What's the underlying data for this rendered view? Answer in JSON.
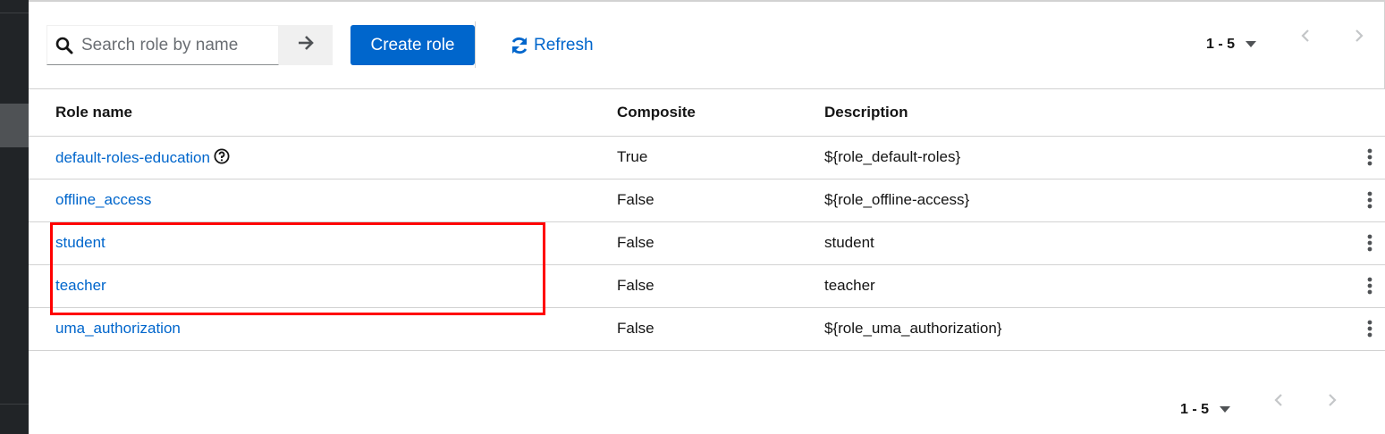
{
  "toolbar": {
    "search_placeholder": "Search role by name",
    "search_value": "",
    "create_label": "Create role",
    "refresh_label": "Refresh",
    "pagination_range": "1 - 5"
  },
  "table": {
    "headers": [
      "Role name",
      "Composite",
      "Description"
    ],
    "rows": [
      {
        "name": "default-roles-education",
        "composite": "True",
        "description": "${role_default-roles}",
        "has_help": true
      },
      {
        "name": "offline_access",
        "composite": "False",
        "description": "${role_offline-access}"
      },
      {
        "name": "student",
        "composite": "False",
        "description": "student"
      },
      {
        "name": "teacher",
        "composite": "False",
        "description": "teacher"
      },
      {
        "name": "uma_authorization",
        "composite": "False",
        "description": "${role_uma_authorization}"
      }
    ]
  },
  "footer": {
    "pagination_range": "1 - 5"
  },
  "colors": {
    "link": "#0066cc",
    "primary_button": "#0066cc",
    "highlight": "#ff0000",
    "sidebar": "#212427"
  },
  "icons": [
    "search-icon",
    "arrow-right-icon",
    "refresh-icon",
    "caret-down-icon",
    "angle-left-icon",
    "angle-right-icon",
    "question-circle-icon",
    "kebab-icon"
  ]
}
